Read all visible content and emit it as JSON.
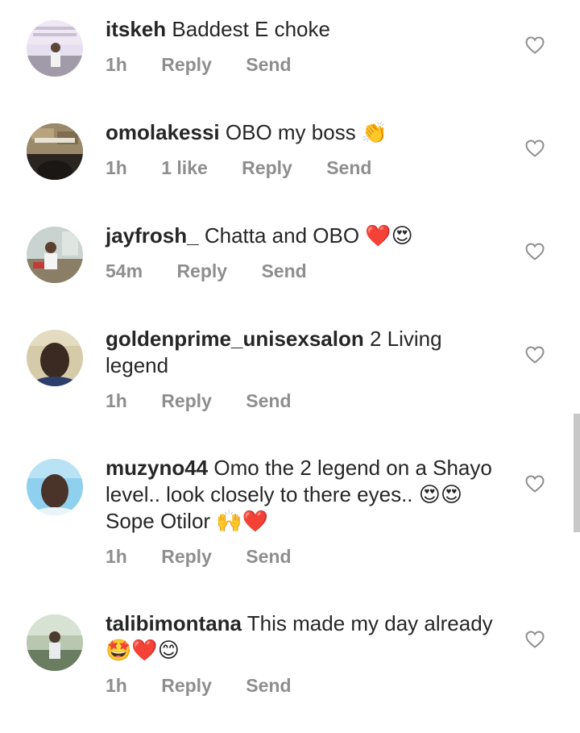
{
  "comments": [
    {
      "username": "itskeh",
      "text": "Baddest E choke",
      "time": "1h",
      "likes": "",
      "reply_label": "Reply",
      "send_label": "Send",
      "avatar_icon": "user-avatar-photo",
      "avatar_colors": [
        "#d9d0e6",
        "#efe8f3"
      ]
    },
    {
      "username": "omolakessi",
      "text": "OBO my boss 👏",
      "time": "1h",
      "likes": "1 like",
      "reply_label": "Reply",
      "send_label": "Send",
      "avatar_icon": "user-avatar-photo",
      "avatar_colors": [
        "#8b7a5a",
        "#2a2520"
      ]
    },
    {
      "username": "jayfrosh_",
      "text": "Chatta and OBO ❤️😍",
      "time": "54m",
      "likes": "",
      "reply_label": "Reply",
      "send_label": "Send",
      "avatar_icon": "user-avatar-photo",
      "avatar_colors": [
        "#c9d3cf",
        "#8a7f66"
      ]
    },
    {
      "username": "goldenprime_unisexsalon",
      "text": "2 Living legend",
      "time": "1h",
      "likes": "",
      "reply_label": "Reply",
      "send_label": "Send",
      "avatar_icon": "user-avatar-photo",
      "avatar_colors": [
        "#cfc4a0",
        "#3b2a22"
      ]
    },
    {
      "username": "muzyno44",
      "text": "Omo the 2 legend on a Shayo level.. look closely to there eyes.. 😍😍 Sope Otilor 🙌❤️",
      "time": "1h",
      "likes": "",
      "reply_label": "Reply",
      "send_label": "Send",
      "avatar_icon": "user-avatar-photo",
      "avatar_colors": [
        "#8fd0ee",
        "#4a3328"
      ]
    },
    {
      "username": "talibimontana",
      "text": "This made my day already 🤩❤️😊",
      "time": "1h",
      "likes": "",
      "reply_label": "Reply",
      "send_label": "Send",
      "avatar_icon": "user-avatar-photo",
      "avatar_colors": [
        "#6a7d60",
        "#b7c7b0"
      ]
    }
  ],
  "colors": {
    "text": "#262626",
    "meta": "#8e8e8e",
    "heart_stroke": "#8e8e8e"
  }
}
